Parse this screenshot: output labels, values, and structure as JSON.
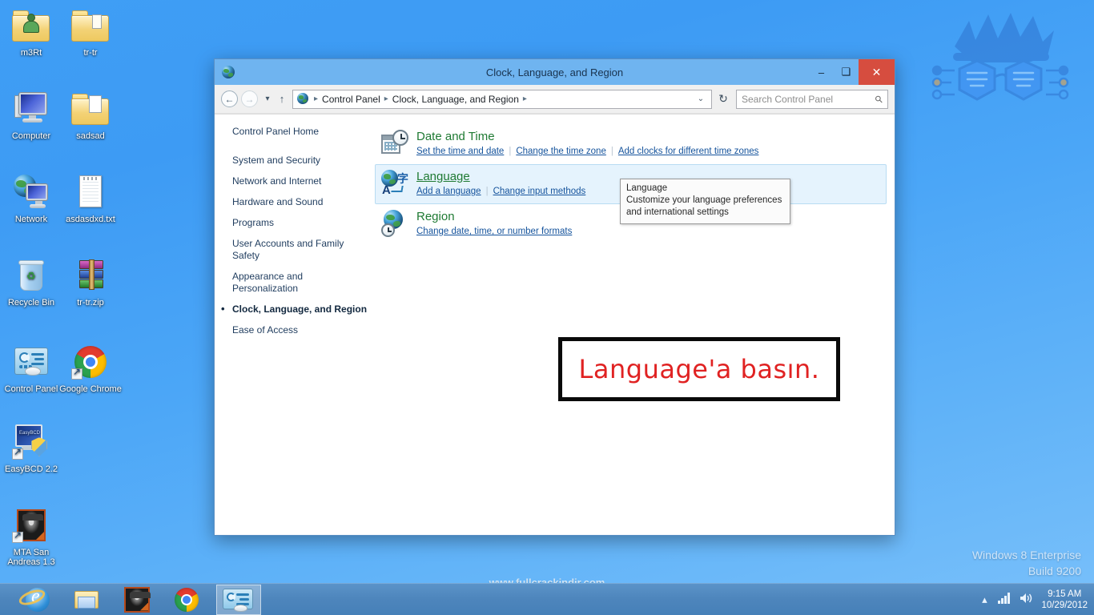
{
  "desktop": {
    "icons": [
      {
        "name": "m3Rt",
        "type": "folder-user"
      },
      {
        "name": "tr-tr",
        "type": "folder"
      },
      {
        "name": "Computer",
        "type": "computer"
      },
      {
        "name": "sadsad",
        "type": "folder-open"
      },
      {
        "name": "Network",
        "type": "network"
      },
      {
        "name": "asdasdxd.txt",
        "type": "textfile"
      },
      {
        "name": "Recycle Bin",
        "type": "recyclebin"
      },
      {
        "name": "tr-tr.zip",
        "type": "archive"
      },
      {
        "name": "Control Panel",
        "type": "controlpanel"
      },
      {
        "name": "Google Chrome",
        "type": "chrome"
      },
      {
        "name": "EasyBCD 2.2",
        "type": "easybcd"
      },
      {
        "name": "MTA San Andreas 1.3",
        "type": "mta"
      }
    ],
    "watermark": "www.fullcrackindir.com",
    "version_line1": "Windows 8 Enterprise",
    "version_line2": "Build 9200"
  },
  "window": {
    "title": "Clock, Language, and Region",
    "minimize_label": "–",
    "maximize_label": "❑",
    "close_label": "✕",
    "nav": {
      "back_label": "←",
      "forward_label": "→",
      "recent_label": "▾",
      "up_label": "↑",
      "dropdown_label": "⌄",
      "refresh_label": "↻"
    },
    "breadcrumb": [
      "Control Panel",
      "Clock, Language, and Region"
    ],
    "breadcrumb_separator": "▸",
    "search_placeholder": "Search Control Panel",
    "search_value": "",
    "search_icon": "⚲"
  },
  "sidebar": {
    "home": "Control Panel Home",
    "items": [
      {
        "label": "System and Security",
        "current": false
      },
      {
        "label": "Network and Internet",
        "current": false
      },
      {
        "label": "Hardware and Sound",
        "current": false
      },
      {
        "label": "Programs",
        "current": false
      },
      {
        "label": "User Accounts and Family Safety",
        "current": false
      },
      {
        "label": "Appearance and Personalization",
        "current": false
      },
      {
        "label": "Clock, Language, and Region",
        "current": true
      },
      {
        "label": "Ease of Access",
        "current": false
      }
    ]
  },
  "categories": [
    {
      "title": "Date and Time",
      "links": [
        "Set the time and date",
        "Change the time zone",
        "Add clocks for different time zones"
      ],
      "selected": false
    },
    {
      "title": "Language",
      "links": [
        "Add a language",
        "Change input methods"
      ],
      "selected": true
    },
    {
      "title": "Region",
      "links": [
        "Change date, time, or number formats"
      ],
      "selected": false
    }
  ],
  "tooltip": {
    "title": "Language",
    "line1": "Customize your language preferences",
    "line2": "and international settings"
  },
  "annotation": {
    "text": "Language'a basın."
  },
  "taskbar": {
    "items": [
      {
        "name": "Internet Explorer",
        "active": false
      },
      {
        "name": "File Explorer",
        "active": false
      },
      {
        "name": "MTA San Andreas",
        "active": false
      },
      {
        "name": "Google Chrome",
        "active": false
      },
      {
        "name": "Control Panel",
        "active": true
      }
    ],
    "tray": {
      "show_hidden": "▴",
      "network": "▮▮▮",
      "volume": "🔊",
      "time": "9:15 AM",
      "date": "10/29/2012"
    }
  },
  "colors": {
    "accent": "#6fb4f0",
    "close": "#d64d3f",
    "category_title": "#1f7a33",
    "link": "#15539c",
    "annotation": "#e02222",
    "selected_row": "#e5f3fd"
  }
}
